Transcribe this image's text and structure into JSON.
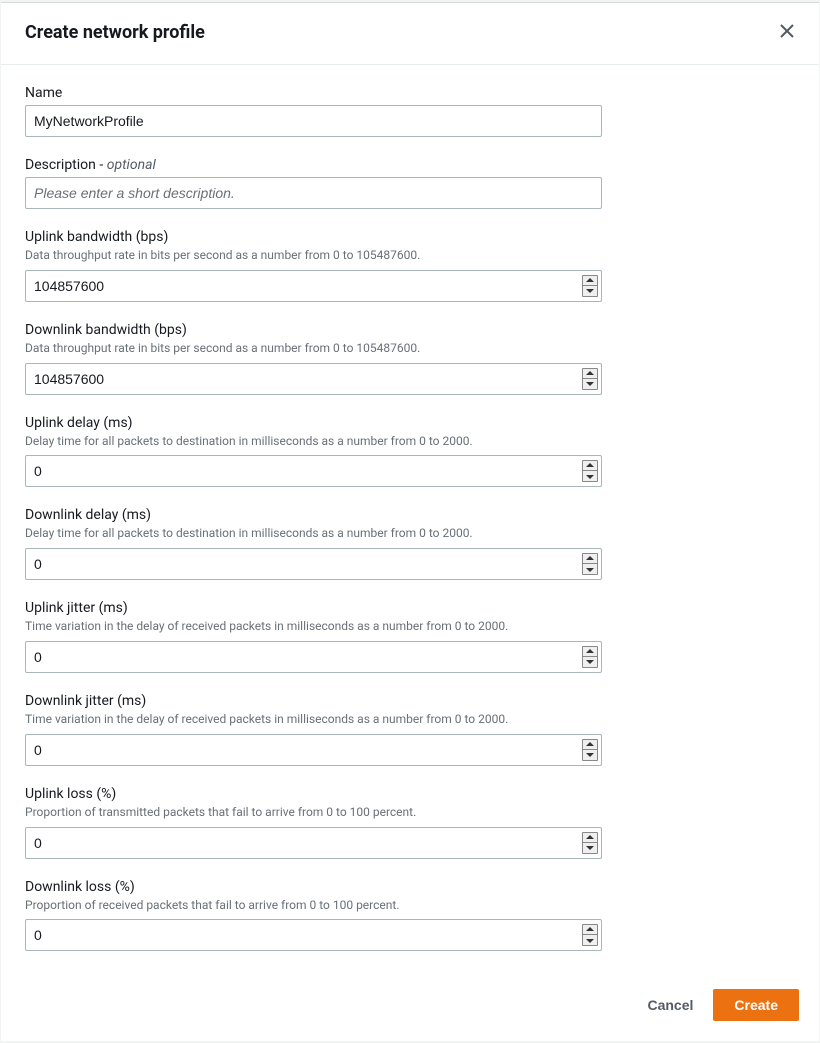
{
  "header": {
    "title": "Create network profile"
  },
  "fields": {
    "name": {
      "label": "Name",
      "value": "MyNetworkProfile"
    },
    "description": {
      "label": "Description - ",
      "optional": "optional",
      "placeholder": "Please enter a short description.",
      "value": ""
    },
    "uplinkBandwidth": {
      "label": "Uplink bandwidth (bps)",
      "help": "Data throughput rate in bits per second as a number from 0 to 105487600.",
      "value": "104857600"
    },
    "downlinkBandwidth": {
      "label": "Downlink bandwidth (bps)",
      "help": "Data throughput rate in bits per second as a number from 0 to 105487600.",
      "value": "104857600"
    },
    "uplinkDelay": {
      "label": "Uplink delay (ms)",
      "help": "Delay time for all packets to destination in milliseconds as a number from 0 to 2000.",
      "value": "0"
    },
    "downlinkDelay": {
      "label": "Downlink delay (ms)",
      "help": "Delay time for all packets to destination in milliseconds as a number from 0 to 2000.",
      "value": "0"
    },
    "uplinkJitter": {
      "label": "Uplink jitter (ms)",
      "help": "Time variation in the delay of received packets in milliseconds as a number from 0 to 2000.",
      "value": "0"
    },
    "downlinkJitter": {
      "label": "Downlink jitter (ms)",
      "help": "Time variation in the delay of received packets in milliseconds as a number from 0 to 2000.",
      "value": "0"
    },
    "uplinkLoss": {
      "label": "Uplink loss (%)",
      "help": "Proportion of transmitted packets that fail to arrive from 0 to 100 percent.",
      "value": "0"
    },
    "downlinkLoss": {
      "label": "Downlink loss (%)",
      "help": "Proportion of received packets that fail to arrive from 0 to 100 percent.",
      "value": "0"
    }
  },
  "footer": {
    "cancel": "Cancel",
    "create": "Create"
  }
}
